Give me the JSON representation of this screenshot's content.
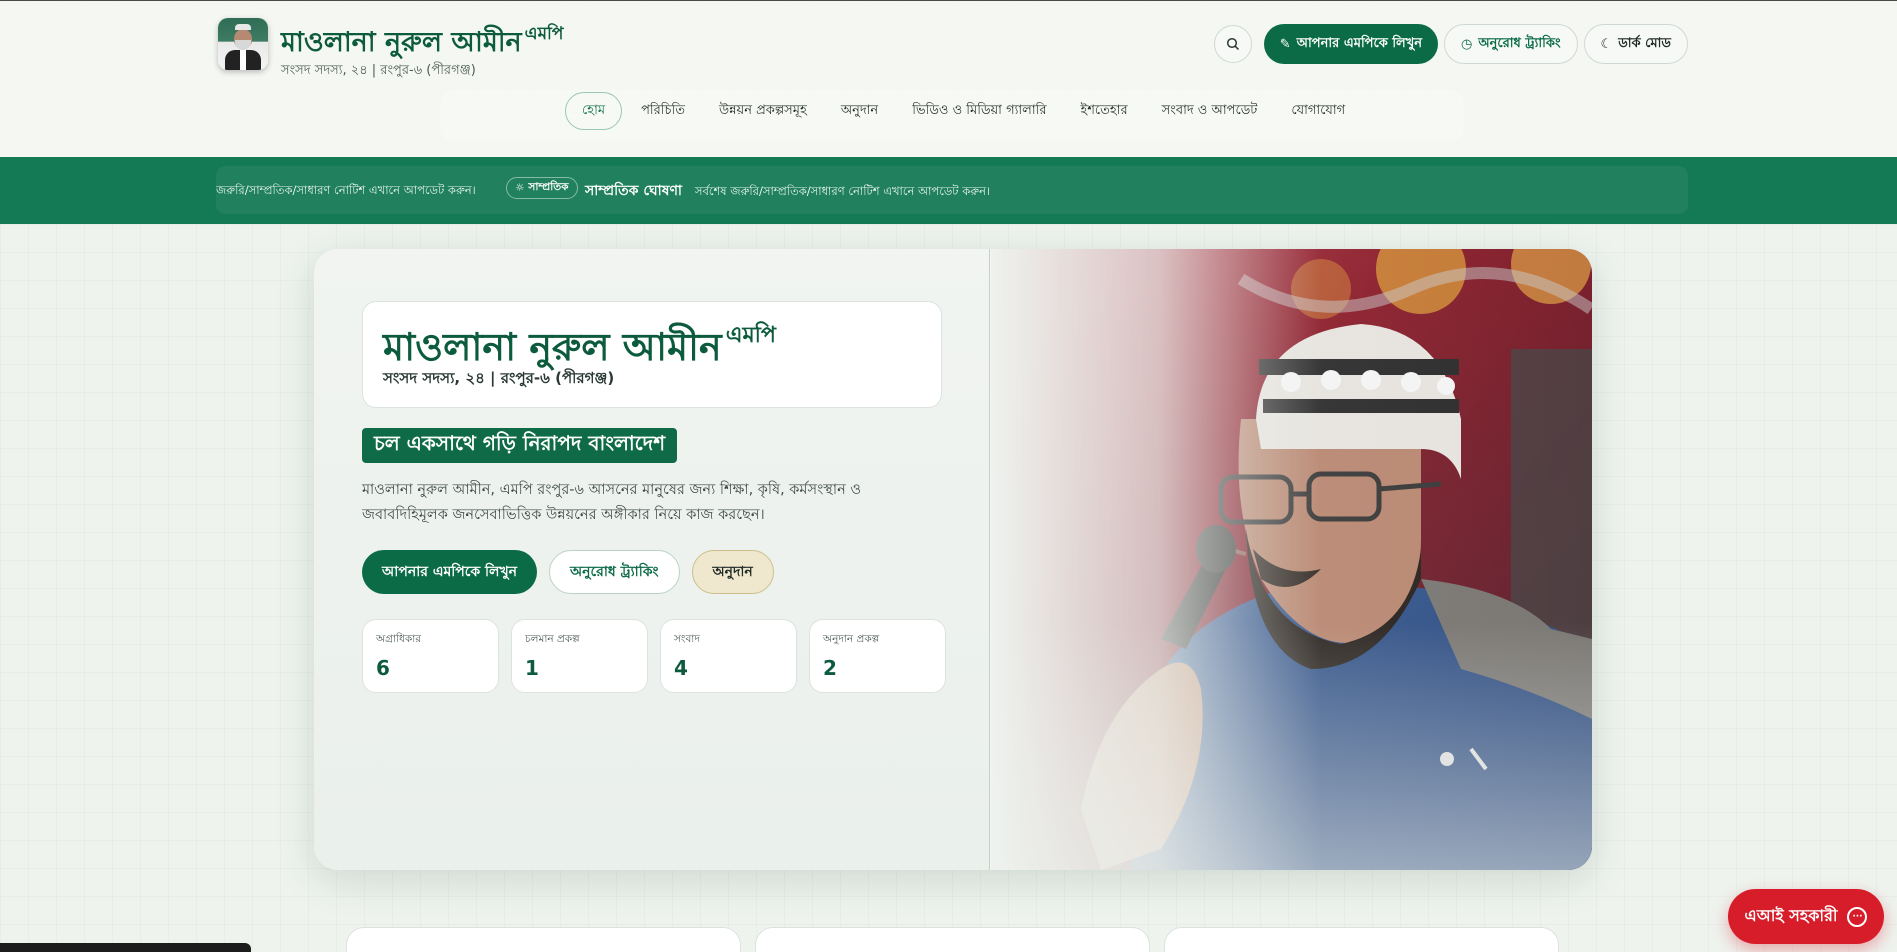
{
  "header": {
    "name": "মাওলানা নুরুল আমীন",
    "name_suffix": "এমপি",
    "subtitle": "সংসদ সদস্য, ২৪ | রংপুর-৬ (পীরগঞ্জ)",
    "actions": {
      "write_mp": "আপনার এমপিকে লিখুন",
      "request_tracking": "অনুরোধ ট্র্যাকিং",
      "dark_mode": "ডার্ক মোড"
    }
  },
  "nav": {
    "items": [
      "হোম",
      "পরিচিতি",
      "উন্নয়ন প্রকল্পসমূহ",
      "অনুদান",
      "ভিডিও ও মিডিয়া গ্যালারি",
      "ইশতেহার",
      "সংবাদ ও আপডেট",
      "যোগাযোগ"
    ],
    "active": "হোম"
  },
  "ticker": {
    "scroll_text": "জরুরি/সাম্প্রতিক/সাধারণ নোটিশ এখানে আপডেট করুন।",
    "badge": "সাম্প্রতিক",
    "title": "সাম্প্রতিক ঘোষণা",
    "latest_text": "সর্বশেষ জরুরি/সাম্প্রতিক/সাধারণ নোটিশ এখানে আপডেট করুন।"
  },
  "hero": {
    "name": "মাওলানা নুরুল আমীন",
    "name_suffix": "এমপি",
    "subtitle": "সংসদ সদস্য, ২৪ | রংপুর-৬ (পীরগঞ্জ)",
    "slogan": "চল একসাথে গড়ি নিরাপদ বাংলাদেশ",
    "description": "মাওলানা নুরুল আমীন, এমপি রংপুর-৬ আসনের মানুষের জন্য শিক্ষা, কৃষি, কর্মসংস্থান ও জবাবদিহিমূলক জনসেবাভিত্তিক উন্নয়নের অঙ্গীকার নিয়ে কাজ করছেন।",
    "buttons": {
      "write_mp": "আপনার এমপিকে লিখুন",
      "request_tracking": "অনুরোধ ট্র্যাকিং",
      "grant": "অনুদান"
    },
    "stats": [
      {
        "label": "অগ্রাধিকার",
        "value": "6"
      },
      {
        "label": "চলমান প্রকল্প",
        "value": "1"
      },
      {
        "label": "সংবাদ",
        "value": "4"
      },
      {
        "label": "অনুদান প্রকল্প",
        "value": "2"
      }
    ]
  },
  "ai_assistant": {
    "label": "এআই সহকারী"
  },
  "colors": {
    "brand_green": "#0c6b47",
    "ticker_green": "#147a55",
    "ai_red": "#d81d2a"
  }
}
